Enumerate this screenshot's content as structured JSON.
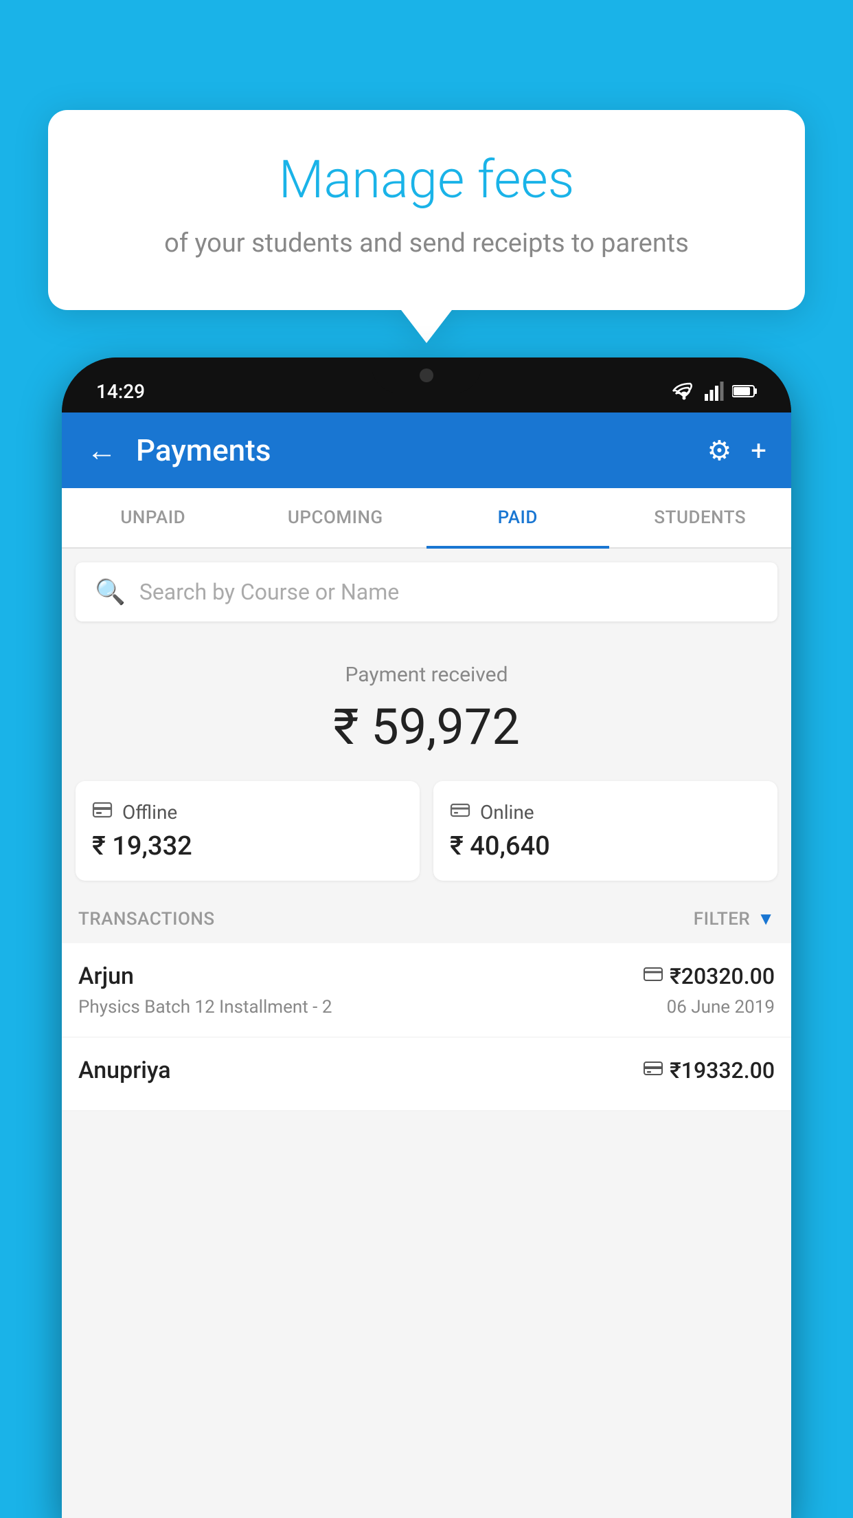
{
  "background_color": "#1ab3e8",
  "speech_bubble": {
    "title": "Manage fees",
    "subtitle": "of your students and send receipts to parents"
  },
  "phone": {
    "status_bar": {
      "time": "14:29",
      "icons": [
        "wifi",
        "signal",
        "battery"
      ]
    },
    "header": {
      "title": "Payments",
      "back_label": "←",
      "settings_icon": "⚙",
      "add_icon": "+"
    },
    "tabs": [
      {
        "label": "UNPAID",
        "active": false
      },
      {
        "label": "UPCOMING",
        "active": false
      },
      {
        "label": "PAID",
        "active": true
      },
      {
        "label": "STUDENTS",
        "active": false
      }
    ],
    "search": {
      "placeholder": "Search by Course or Name"
    },
    "payment_summary": {
      "label": "Payment received",
      "amount": "₹ 59,972",
      "offline": {
        "label": "Offline",
        "amount": "₹ 19,332"
      },
      "online": {
        "label": "Online",
        "amount": "₹ 40,640"
      }
    },
    "transactions_label": "TRANSACTIONS",
    "filter_label": "FILTER",
    "transactions": [
      {
        "name": "Arjun",
        "description": "Physics Batch 12 Installment - 2",
        "amount": "₹20320.00",
        "date": "06 June 2019",
        "type": "online"
      },
      {
        "name": "Anupriya",
        "description": "",
        "amount": "₹19332.00",
        "date": "",
        "type": "offline"
      }
    ]
  }
}
